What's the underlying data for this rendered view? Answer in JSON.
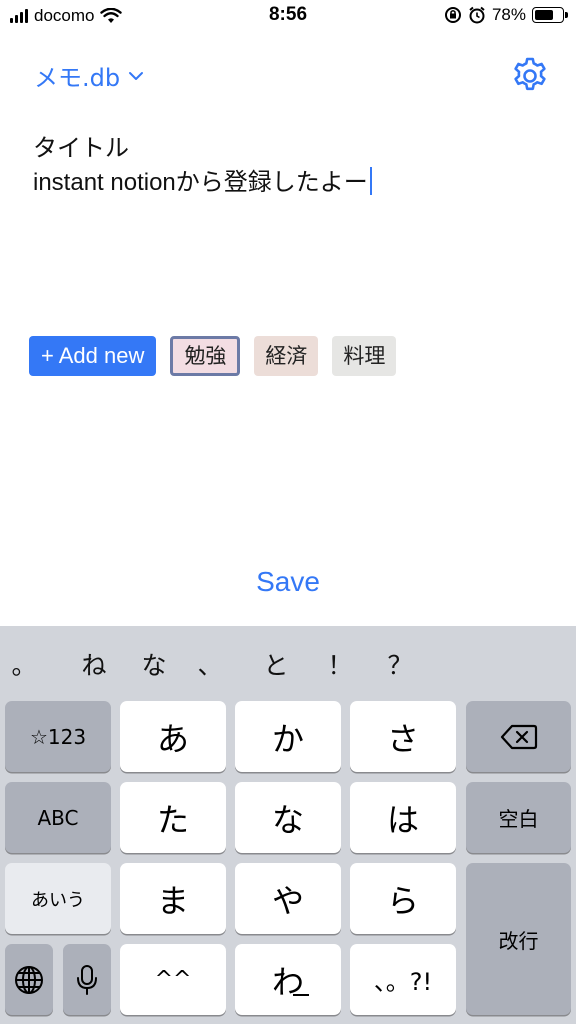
{
  "status_bar": {
    "carrier": "docomo",
    "time": "8:56",
    "battery_percent": "78%",
    "battery_level": 0.78
  },
  "header": {
    "db_name": "メモ.db"
  },
  "editor": {
    "title_line": "タイトル",
    "body_line": "instant notionから登録したよー"
  },
  "tags": {
    "add_label": "+ Add new",
    "items": [
      {
        "label": "勉強",
        "color": "#f3dde3",
        "selected": true
      },
      {
        "label": "経済",
        "color": "#ecddd8",
        "selected": false
      },
      {
        "label": "料理",
        "color": "#e6e6e4",
        "selected": false
      }
    ]
  },
  "save_label": "Save",
  "keyboard": {
    "candidates": [
      "。",
      "ね",
      "な",
      "、",
      "と",
      "！",
      "？"
    ],
    "keys": {
      "symbols": "☆123",
      "a": "あ",
      "ka": "か",
      "sa": "さ",
      "abc": "ABC",
      "ta": "た",
      "na": "な",
      "ha": "は",
      "space": "空白",
      "aiu": "あいう",
      "ma": "ま",
      "ya": "や",
      "ra": "ら",
      "return": "改行",
      "kaomoji": "^^",
      "wa": "わ",
      "punct": "、。?!"
    }
  }
}
